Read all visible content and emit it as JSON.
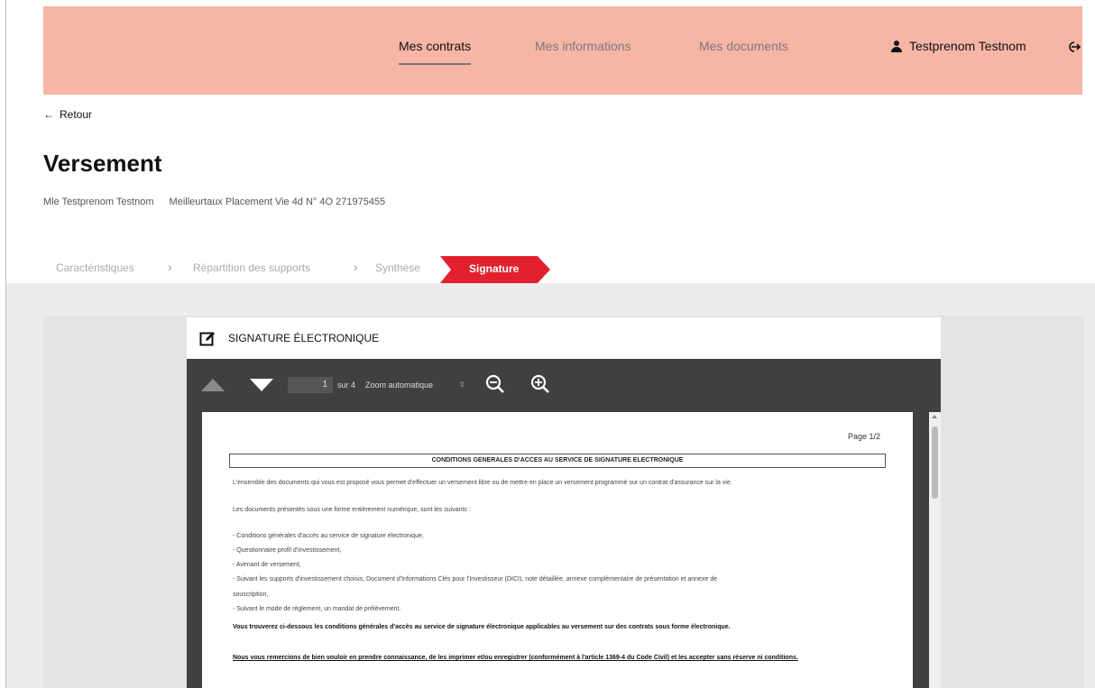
{
  "header": {
    "nav": [
      {
        "label": "Mes contrats"
      },
      {
        "label": "Mes informations"
      },
      {
        "label": "Mes documents"
      }
    ],
    "user_name": "Testprenom Testnom",
    "bg_color": "#f7b5a5"
  },
  "back_label": "Retour",
  "page_title": "Versement",
  "subline": {
    "holder": "Mle Testprenom Testnom",
    "contract": "Meilleurtaux Placement Vie 4d N° 4O 271975455"
  },
  "steps": [
    {
      "label": "Caractéristiques"
    },
    {
      "label": "Répartition des supports"
    },
    {
      "label": "Synthèse"
    },
    {
      "label": "Signature"
    }
  ],
  "accent_color": "#e3202d",
  "panel": {
    "title": "SIGNATURE ÉLECTRONIQUE"
  },
  "viewer": {
    "current_page": "1",
    "total_pages": "sur 4",
    "zoom": "Zoom automatique"
  },
  "pdf": {
    "page_label": "Page 1/2",
    "title": "CONDITIONS GENERALES D'ACCES AU SERVICE DE SIGNATURE ELECTRONIQUE",
    "p1": "L'ensemble des documents qui vous est proposé vous permet d'effectuer un versement libre ou de mettre en place un versement programmé sur un contrat d'assurance sur la vie.",
    "p2": "Les documents présentés sous une forme entièrement numérique, sont les suivants :",
    "li1": "- Conditions générales d'accès au service de signature électronique,",
    "li2": "- Questionnaire profil d'investissement,",
    "li3": "- Avenant de versement,",
    "li4": "- Suivant les supports d'investissement choisis, Document d'Informations Clés pour l'Investisseur (DICI), note détaillée, annexe complémentaire de présentation et annexe de",
    "li4b": "souscription,",
    "li5": "- Suivant le mode de règlement, un mandat de prélèvement.",
    "p3": "Vous trouverez ci-dessous les conditions générales d'accès au service de signature électronique applicables au versement sur des contrats sous forme électronique.",
    "p4": "Nous vous remercions de bien vouloir en prendre connaissance, de les imprimer et/ou enregistrer (conformément à l'article 1369-4 du Code Civil) et les accepter sans réserve ni conditions."
  }
}
